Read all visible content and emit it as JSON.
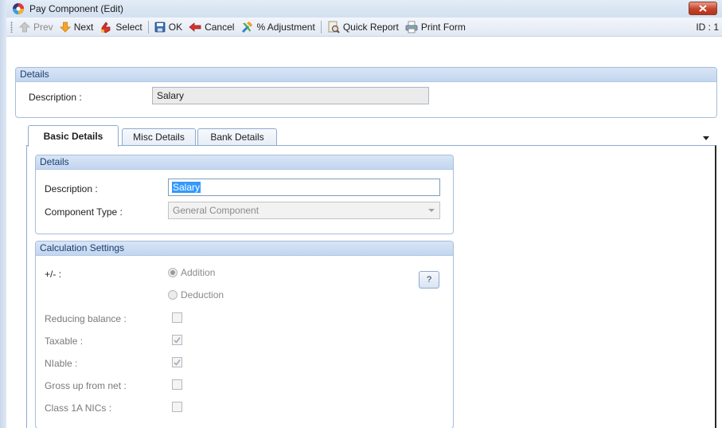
{
  "window": {
    "title": "Pay Component (Edit)"
  },
  "toolbar": {
    "prev": "Prev",
    "next": "Next",
    "select": "Select",
    "ok": "OK",
    "cancel": "Cancel",
    "adjustment": "% Adjustment",
    "quick_report": "Quick Report",
    "print_form": "Print Form",
    "id_label": "ID : 1"
  },
  "header_details": {
    "heading": "Details",
    "description_label": "Description :",
    "description_value": "Salary"
  },
  "tabs": [
    {
      "label": "Basic Details",
      "active": true
    },
    {
      "label": "Misc Details",
      "active": false
    },
    {
      "label": "Bank Details",
      "active": false
    }
  ],
  "basic_details": {
    "heading": "Details",
    "description_label": "Description :",
    "description_value": "Salary",
    "component_type_label": "Component Type :",
    "component_type_value": "General Component"
  },
  "calculation": {
    "heading": "Calculation Settings",
    "sign_label": "+/- :",
    "addition_label": "Addition",
    "deduction_label": "Deduction",
    "selected_sign": "Addition",
    "help_label": "?",
    "reducing_balance_label": "Reducing balance :",
    "reducing_balance_checked": false,
    "taxable_label": "Taxable :",
    "taxable_checked": true,
    "niable_label": "NIable :",
    "niable_checked": true,
    "gross_up_label": "Gross up from net :",
    "gross_up_checked": false,
    "class1a_label": "Class 1A NICs :",
    "class1a_checked": false
  },
  "colors": {
    "group_header": "#c3d6ef",
    "group_border": "#a7bedc",
    "title_close": "#c4442a",
    "selection": "#3399ff"
  }
}
